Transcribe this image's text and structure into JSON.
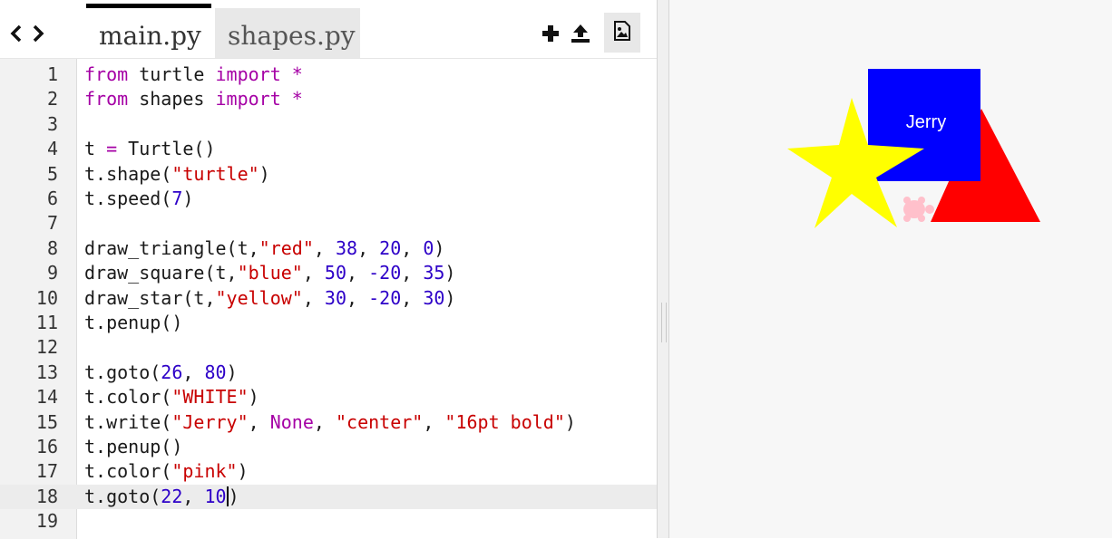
{
  "toolbar": {
    "back_icon": "chevron-left-icon",
    "forward_icon": "chevron-right-icon",
    "tabs": [
      {
        "label": "main.py",
        "active": true
      },
      {
        "label": "shapes.py",
        "active": false
      }
    ],
    "add_icon": "plus-icon",
    "upload_icon": "upload-icon",
    "image_icon": "image-icon"
  },
  "editor": {
    "current_line": 18,
    "lines": [
      {
        "n": "1",
        "text": "from turtle import *"
      },
      {
        "n": "2",
        "text": "from shapes import *"
      },
      {
        "n": "3",
        "text": ""
      },
      {
        "n": "4",
        "text": "t = Turtle()"
      },
      {
        "n": "5",
        "text": "t.shape(\"turtle\")"
      },
      {
        "n": "6",
        "text": "t.speed(7)"
      },
      {
        "n": "7",
        "text": ""
      },
      {
        "n": "8",
        "text": "draw_triangle(t,\"red\", 38, 20, 0)"
      },
      {
        "n": "9",
        "text": "draw_square(t,\"blue\", 50, -20, 35)"
      },
      {
        "n": "10",
        "text": "draw_star(t,\"yellow\", 30, -20, 30)"
      },
      {
        "n": "11",
        "text": "t.penup()"
      },
      {
        "n": "12",
        "text": ""
      },
      {
        "n": "13",
        "text": "t.goto(26, 80)"
      },
      {
        "n": "14",
        "text": "t.color(\"WHITE\")"
      },
      {
        "n": "15",
        "text": "t.write(\"Jerry\", None, \"center\", \"16pt bold\")"
      },
      {
        "n": "16",
        "text": "t.penup()"
      },
      {
        "n": "17",
        "text": "t.color(\"pink\")"
      },
      {
        "n": "18",
        "text": "t.goto(22, 10)"
      },
      {
        "n": "19",
        "text": ""
      }
    ],
    "colors": {
      "keyword": "#a500a5",
      "string": "#c80000",
      "number": "#2d00c8"
    }
  },
  "output": {
    "label_text": "Jerry",
    "colors": {
      "square": "#0000ff",
      "triangle": "#ff0000",
      "star": "#ffff00",
      "turtle": "#ffc0cb"
    }
  }
}
